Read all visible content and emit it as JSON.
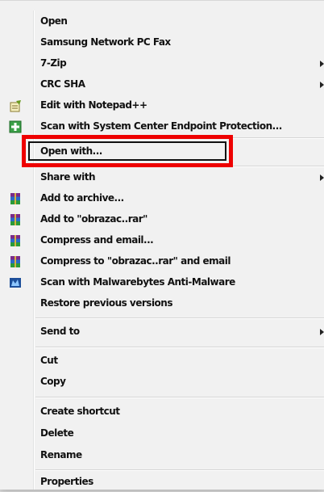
{
  "menu": {
    "items": [
      {
        "label": "Open",
        "submenu": false,
        "icon": null
      },
      {
        "label": "Samsung Network PC Fax",
        "submenu": false,
        "icon": null
      },
      {
        "label": "7-Zip",
        "submenu": true,
        "icon": null
      },
      {
        "label": "CRC SHA",
        "submenu": true,
        "icon": null
      },
      {
        "label": "Edit with Notepad++",
        "submenu": false,
        "icon": "notepadpp-icon"
      },
      {
        "label": "Scan with System Center Endpoint Protection...",
        "submenu": false,
        "icon": "endpoint-protection-icon"
      },
      {
        "label": "Open with...",
        "submenu": false,
        "icon": null
      },
      {
        "label": "Share with",
        "submenu": true,
        "icon": null
      },
      {
        "label": "Add to archive...",
        "submenu": false,
        "icon": "winrar-icon"
      },
      {
        "label": "Add to \"obrazac..rar\"",
        "submenu": false,
        "icon": "winrar-icon"
      },
      {
        "label": "Compress and email...",
        "submenu": false,
        "icon": "winrar-icon"
      },
      {
        "label": "Compress to \"obrazac..rar\" and email",
        "submenu": false,
        "icon": "winrar-icon"
      },
      {
        "label": "Scan with Malwarebytes Anti-Malware",
        "submenu": false,
        "icon": "malwarebytes-icon"
      },
      {
        "label": "Restore previous versions",
        "submenu": false,
        "icon": null
      },
      {
        "label": "Send to",
        "submenu": true,
        "icon": null
      },
      {
        "label": "Cut",
        "submenu": false,
        "icon": null
      },
      {
        "label": "Copy",
        "submenu": false,
        "icon": null
      },
      {
        "label": "Create shortcut",
        "submenu": false,
        "icon": null
      },
      {
        "label": "Delete",
        "submenu": false,
        "icon": null
      },
      {
        "label": "Rename",
        "submenu": false,
        "icon": null
      },
      {
        "label": "Properties",
        "submenu": false,
        "icon": null
      }
    ]
  },
  "colors": {
    "highlight": "#ee0000",
    "menu_bg": "#f1f1f1",
    "text": "#111111"
  }
}
